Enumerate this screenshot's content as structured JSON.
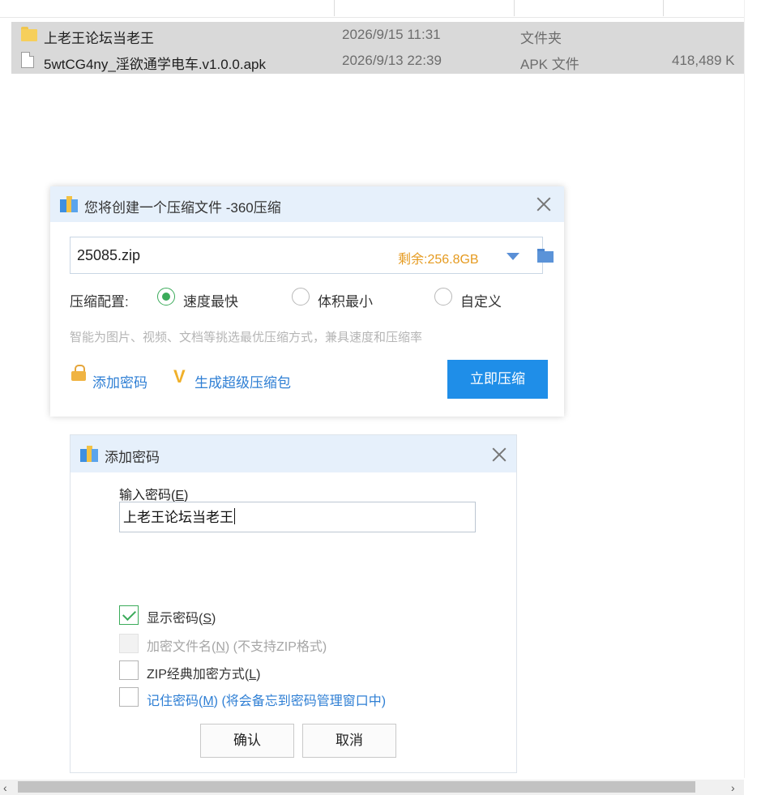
{
  "explorer": {
    "files": [
      {
        "name": "上老王论坛当老王",
        "date": "2026/9/15 11:31",
        "type": "文件夹",
        "size": "",
        "icon": "folder-icon"
      },
      {
        "name": "5wtCG4ny_淫欲通学电车.v1.0.0.apk",
        "date": "2026/9/13 22:39",
        "type": "APK 文件",
        "size": "418,489 K",
        "icon": "file-icon"
      }
    ]
  },
  "compress_dialog": {
    "title": "您将创建一个压缩文件 -360压缩",
    "filename": "25085.zip",
    "remaining": "剩余:256.8GB",
    "config_label": "压缩配置:",
    "options": [
      {
        "label": "速度最快",
        "selected": true
      },
      {
        "label": "体积最小",
        "selected": false
      },
      {
        "label": "自定义",
        "selected": false
      }
    ],
    "hint": "智能为图片、视频、文档等挑选最优压缩方式，兼具速度和压缩率",
    "add_password_link": "添加密码",
    "super_pack_link": "生成超级压缩包",
    "compress_button": "立即压缩"
  },
  "password_dialog": {
    "title": "添加密码",
    "input_label": "输入密码(",
    "input_label_key": "E",
    "input_label_end": ")",
    "password_value": "上老王论坛当老王",
    "checkboxes": [
      {
        "pre": "显示密码(",
        "key": "S",
        "post": ")",
        "checked": true,
        "disabled": false,
        "link": false
      },
      {
        "pre": "加密文件名(",
        "key": "N",
        "post": ") (不支持ZIP格式)",
        "checked": false,
        "disabled": true,
        "link": false
      },
      {
        "pre": "ZIP经典加密方式(",
        "key": "L",
        "post": ")",
        "checked": false,
        "disabled": false,
        "link": false
      },
      {
        "pre": "记住密码(",
        "key": "M",
        "post": ") (将会备忘到密码管理窗口中)",
        "checked": false,
        "disabled": false,
        "link": true
      }
    ],
    "ok_button": "确认",
    "cancel_button": "取消"
  },
  "scrollbar": {
    "left_arrow": "‹",
    "right_arrow": "›"
  },
  "colors": {
    "accent_blue": "#1f8ee8",
    "check_green": "#3bab5a",
    "remain_orange": "#e59a1f",
    "selection_gray": "#d9d9d9"
  }
}
